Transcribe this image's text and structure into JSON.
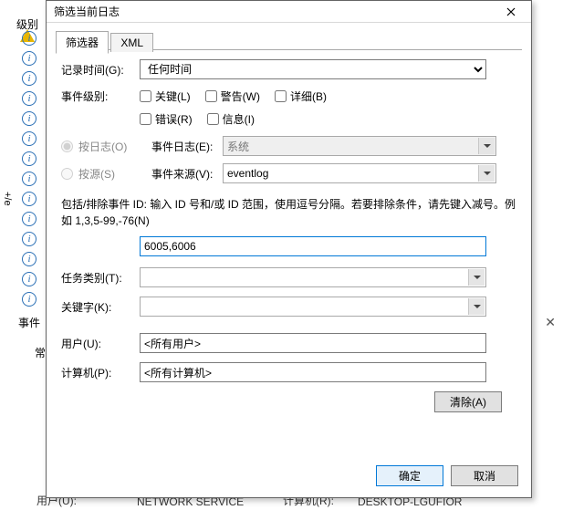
{
  "background": {
    "column_header": "级别",
    "side_text": "+/e",
    "event_label": "事件",
    "chang_label": "常",
    "footer_user_label": "用户(U):",
    "footer_user_value": "NETWORK SERVICE",
    "footer_computer_label": "计算机(R):",
    "footer_computer_value": "DESKTOP-LGUFIOR"
  },
  "dialog": {
    "title": "筛选当前日志",
    "tabs": {
      "filter": "筛选器",
      "xml": "XML"
    },
    "logged": {
      "label": "记录时间(G):",
      "value": "任何时间"
    },
    "level": {
      "label": "事件级别:",
      "critical": "关键(L)",
      "warning": "警告(W)",
      "verbose": "详细(B)",
      "error": "错误(R)",
      "information": "信息(I)"
    },
    "by_log": {
      "radio": "按日志(O)",
      "label": "事件日志(E):",
      "value": "系统"
    },
    "by_source": {
      "radio": "按源(S)",
      "label": "事件来源(V):",
      "value": "eventlog"
    },
    "id_desc": "包括/排除事件 ID: 输入 ID 号和/或 ID 范围，使用逗号分隔。若要排除条件，请先键入减号。例如 1,3,5-99,-76(N)",
    "id_value": "6005,6006",
    "task": {
      "label": "任务类别(T):",
      "value": ""
    },
    "keywords": {
      "label": "关键字(K):",
      "value": ""
    },
    "user": {
      "label": "用户(U):",
      "value": "<所有用户>"
    },
    "computer": {
      "label": "计算机(P):",
      "value": "<所有计算机>"
    },
    "clear": "清除(A)",
    "ok": "确定",
    "cancel": "取消"
  }
}
